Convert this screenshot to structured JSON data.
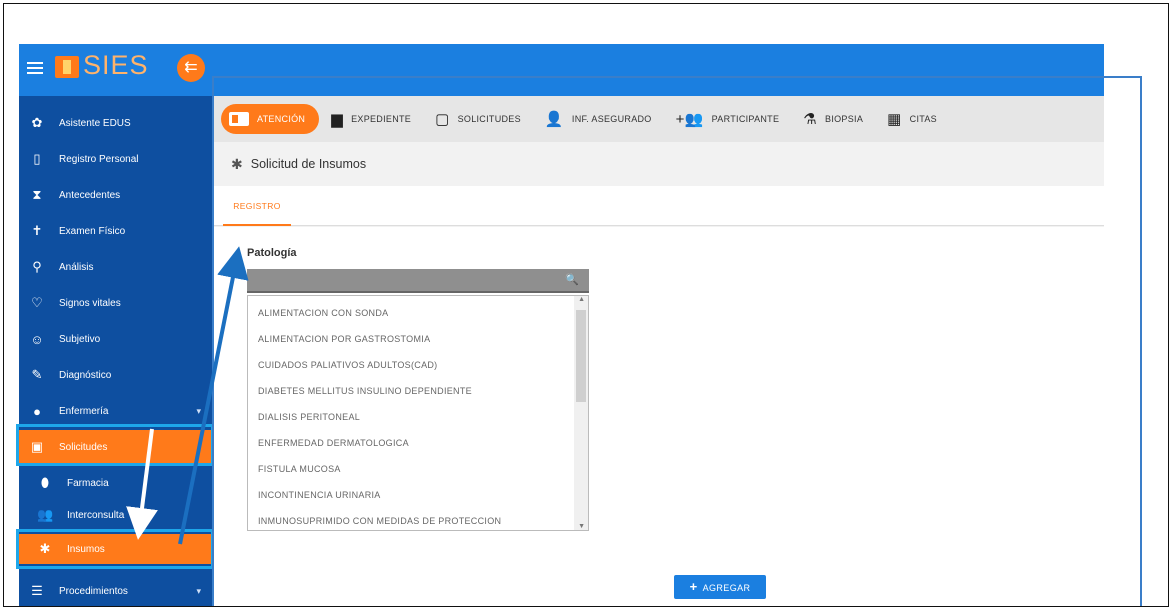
{
  "app": {
    "title": "SIES"
  },
  "sidebar": {
    "items": [
      {
        "label": "Asistente EDUS",
        "icon": "gear-icon"
      },
      {
        "label": "Registro Personal",
        "icon": "tablet-icon"
      },
      {
        "label": "Antecedentes",
        "icon": "hourglass-icon"
      },
      {
        "label": "Examen Físico",
        "icon": "person-icon"
      },
      {
        "label": "Análisis",
        "icon": "magnifier-icon"
      },
      {
        "label": "Signos vitales",
        "icon": "heart-icon"
      },
      {
        "label": "Subjetivo",
        "icon": "smiley-icon"
      },
      {
        "label": "Diagnóstico",
        "icon": "pencil-icon"
      },
      {
        "label": "Enfermería",
        "icon": "pin-icon"
      },
      {
        "label": "Solicitudes",
        "icon": "monitor-icon"
      },
      {
        "label": "Farmacia",
        "icon": "pill-icon"
      },
      {
        "label": "Interconsulta",
        "icon": "group-icon"
      },
      {
        "label": "Insumos",
        "icon": "bandage-icon"
      },
      {
        "label": "Procedimientos",
        "icon": "list-icon"
      }
    ]
  },
  "tabs": [
    {
      "label": "ATENCIÓN",
      "icon": "clipboard-icon"
    },
    {
      "label": "EXPEDIENTE",
      "icon": "id-card-icon"
    },
    {
      "label": "SOLICITUDES",
      "icon": "monitor-icon"
    },
    {
      "label": "INF. ASEGURADO",
      "icon": "person-icon"
    },
    {
      "label": "PARTICIPANTE",
      "icon": "add-group-icon"
    },
    {
      "label": "BIOPSIA",
      "icon": "microscope-icon"
    },
    {
      "label": "CITAS",
      "icon": "calendar-icon"
    }
  ],
  "page": {
    "title": "Solicitud de Insumos",
    "subtab": "REGISTRO"
  },
  "form": {
    "patologia_label": "Patología",
    "search_value": "",
    "options": [
      "ALIMENTACION CON SONDA",
      "ALIMENTACION POR GASTROSTOMIA",
      "CUIDADOS PALIATIVOS ADULTOS(CAD)",
      "DIABETES MELLITUS INSULINO DEPENDIENTE",
      "DIALISIS PERITONEAL",
      "ENFERMEDAD DERMATOLOGICA",
      "FISTULA MUCOSA",
      "INCONTINENCIA URINARIA",
      "INMUNOSUPRIMIDO CON MEDIDAS DE PROTECCION"
    ],
    "add_button": "AGREGAR"
  },
  "colors": {
    "accent": "#ff7a1a",
    "primary": "#1b7fe0",
    "sidebar": "#0e4fa0",
    "annotation": "#1ea7ea"
  }
}
